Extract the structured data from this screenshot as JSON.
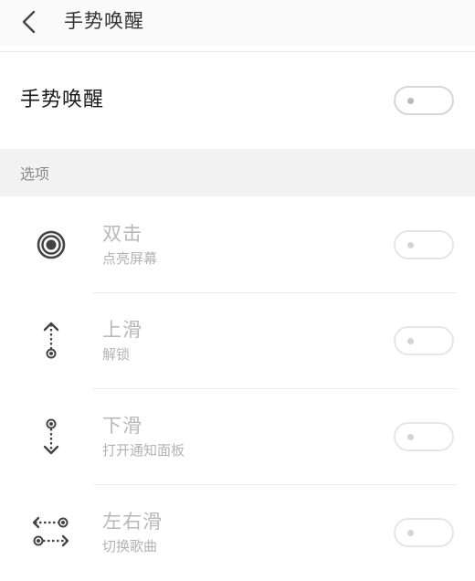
{
  "header": {
    "back_icon": "back-arrow-icon",
    "title": "手势唤醒"
  },
  "master": {
    "label": "手势唤醒",
    "enabled": false
  },
  "section": {
    "label": "选项"
  },
  "options": [
    {
      "icon": "double-tap-icon",
      "title": "双击",
      "subtitle": "点亮屏幕",
      "enabled": false
    },
    {
      "icon": "swipe-up-icon",
      "title": "上滑",
      "subtitle": "解锁",
      "enabled": false
    },
    {
      "icon": "swipe-down-icon",
      "title": "下滑",
      "subtitle": "打开通知面板",
      "enabled": false
    },
    {
      "icon": "swipe-left-right-icon",
      "title": "左右滑",
      "subtitle": "切换歌曲",
      "enabled": false
    }
  ],
  "colors": {
    "disabled_text": "#b8b8b8",
    "toggle_border": "#e6e6e6"
  }
}
